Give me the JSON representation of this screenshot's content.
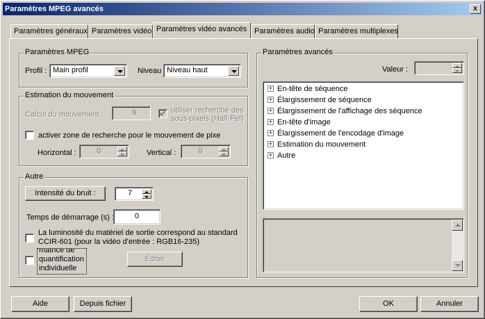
{
  "window": {
    "title": "Paramètres MPEG avancés",
    "close_glyph": "x"
  },
  "tabs": [
    {
      "label": "Paramètres généraux"
    },
    {
      "label": "Paramètres vidéo"
    },
    {
      "label": "Paramètres vidéo avancés"
    },
    {
      "label": "Paramètres audio"
    },
    {
      "label": "Paramètres multiplexes"
    }
  ],
  "active_tab": "Paramètres vidéo avancés",
  "mpeg": {
    "legend": "Paramètres MPEG",
    "profile_label": "Profil :",
    "profile_value": "Main profil",
    "level_label": "Niveau",
    "level_value": "Niveau haut"
  },
  "motion": {
    "legend": "Estimation du mouvement",
    "calc_label": "Calcul du mouvement :",
    "calc_value": "9",
    "subpixel_label_1": "utiliser recherche des",
    "subpixel_label_2": "sous-pixels (Half-Pel)",
    "subpixel_checked": true,
    "search_zone_label": "activer zone de recherche pour le mouvement de pixe",
    "search_zone_checked": false,
    "horizontal_label": "Horizontal :",
    "horizontal_value": "0",
    "vertical_label": "Vertical :",
    "vertical_value": "0"
  },
  "other": {
    "legend": "Autre",
    "noise_button": "Intensité du bruit :",
    "noise_value": "7",
    "startup_label": "Temps de démarrage (s) :",
    "startup_value": "0",
    "ccir_label_1": "La luminosité du matériel de sortie correspond au standard",
    "ccir_label_2": "CCIR-601 (pour la vidéo d'entrée : RGB16-235)",
    "ccir_checked": false,
    "matrix_label_1": "matrice de",
    "matrix_label_2": "quantification",
    "matrix_label_3": "individuelle",
    "matrix_checked": false,
    "edit_button": "Éditer"
  },
  "advanced": {
    "legend": "Paramètres avancés",
    "value_label": "Valeur :",
    "value": "",
    "tree": [
      "En-tête de séquence",
      "Élargissement de séquence",
      "Élargissement de l'affichage des séquence",
      "En-tête d'image",
      "Élargissement de l'encodage d'image",
      "Estimation du mouvement",
      "Autre"
    ],
    "expander_glyph": "+"
  },
  "footer": {
    "help": "Aide",
    "from_file": "Depuis fichier",
    "ok": "OK",
    "cancel": "Annuler"
  }
}
